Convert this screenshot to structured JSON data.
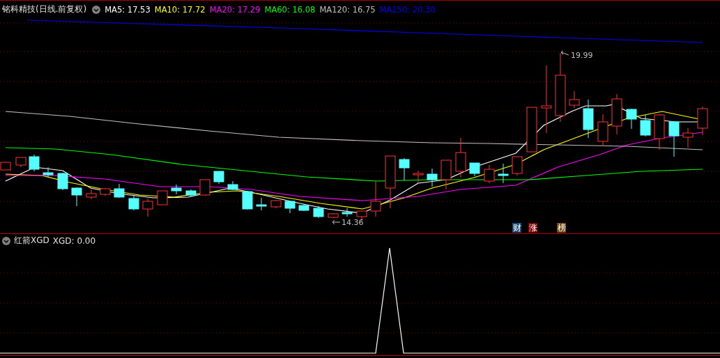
{
  "chart_header": {
    "title": "铭科精技(日线.前复权)",
    "legend": [
      {
        "label": "MA5: 17.53",
        "color": "#ffffff"
      },
      {
        "label": "MA10: 17.72",
        "color": "#ffff00"
      },
      {
        "label": "MA20: 17.29",
        "color": "#ff00ff"
      },
      {
        "label": "MA60: 16.08",
        "color": "#00ff00"
      },
      {
        "label": "MA120: 16.75",
        "color": "#c0c0c0"
      },
      {
        "label": "MA250: 20.30",
        "color": "#0000ff"
      }
    ]
  },
  "price_marks": {
    "high": "19.99",
    "low": "14.36"
  },
  "badges": [
    {
      "label": "财",
      "color": "#1a4a7c"
    },
    {
      "label": "涨",
      "color": "#800000"
    },
    {
      "label": "榜",
      "color": "#7a4a14"
    }
  ],
  "indicator_header": {
    "name": "红箭XGD",
    "value": "XGD: 0.00"
  }
}
